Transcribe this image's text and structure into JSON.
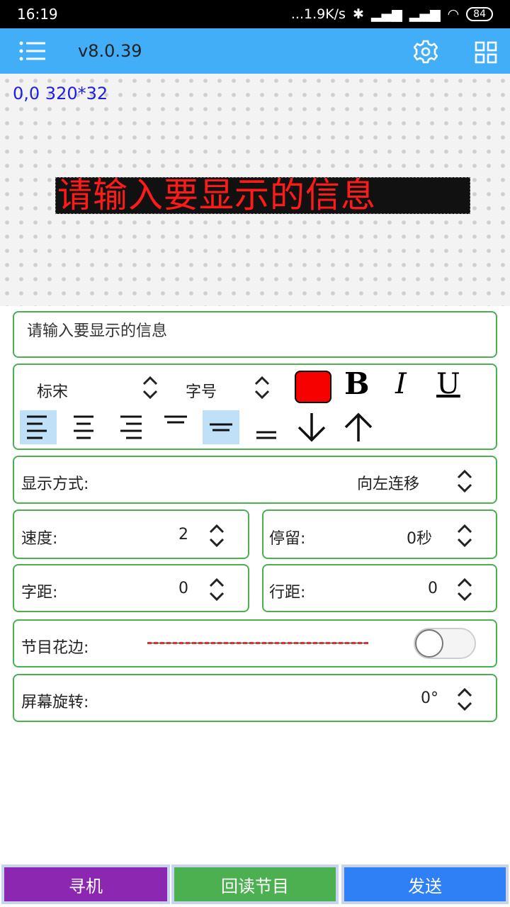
{
  "status": {
    "time": "16:19",
    "network": "...1.9K/s",
    "battery": "84"
  },
  "header": {
    "version": "v8.0.39"
  },
  "preview": {
    "coords": "0,0 320*32",
    "text": "请输入要显示的信息",
    "text_color": "#ff1a1a"
  },
  "input": {
    "value": "请输入要显示的信息"
  },
  "format": {
    "font": "标宋",
    "size_label": "字号",
    "color": "#f70000",
    "bold": "B",
    "italic": "I",
    "underline": "U",
    "h_align_selected": "left",
    "v_align_selected": "middle"
  },
  "display_mode": {
    "label": "显示方式:",
    "value": "向左连移"
  },
  "speed": {
    "label": "速度:",
    "value": "2"
  },
  "pause": {
    "label": "停留:",
    "value": "0秒"
  },
  "char_spacing": {
    "label": "字距:",
    "value": "0"
  },
  "line_spacing": {
    "label": "行距:",
    "value": "0"
  },
  "border": {
    "label": "节目花边:",
    "enabled": false
  },
  "rotation": {
    "label": "屏幕旋转:",
    "value": "0°"
  },
  "footer": {
    "search": {
      "label": "寻机",
      "color": "#8c27b2"
    },
    "readback": {
      "label": "回读节目",
      "color": "#4caf50"
    },
    "send": {
      "label": "发送",
      "color": "#2f7ff5"
    }
  }
}
